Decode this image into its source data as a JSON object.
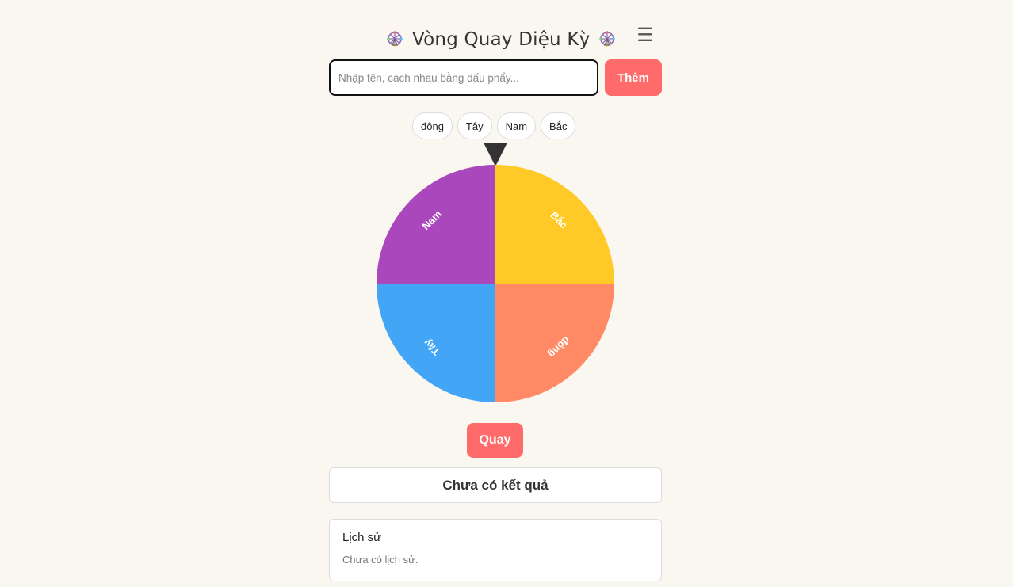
{
  "header": {
    "title": "Vòng Quay Diệu Kỳ",
    "icon": "ferris-wheel-icon",
    "menu_icon": "☰"
  },
  "input": {
    "placeholder": "Nhập tên, cách nhau bằng dấu phẩy...",
    "value": "",
    "add_label": "Thêm"
  },
  "chips": [
    "đông",
    "Tây",
    "Nam",
    "Bắc"
  ],
  "wheel": {
    "segments": [
      {
        "label": "Bắc",
        "color": "#ffca28"
      },
      {
        "label": "đông",
        "color": "#ff8a65"
      },
      {
        "label": "Tây",
        "color": "#42a5f5"
      },
      {
        "label": "Nam",
        "color": "#ab47bc"
      }
    ],
    "pointer_color": "#333333"
  },
  "spin": {
    "label": "Quay"
  },
  "result": {
    "text": "Chưa có kết quả"
  },
  "history": {
    "title": "Lịch sử",
    "empty": "Chưa có lịch sử."
  },
  "colors": {
    "accent": "#ff6b6b",
    "background": "#faf6f0"
  }
}
